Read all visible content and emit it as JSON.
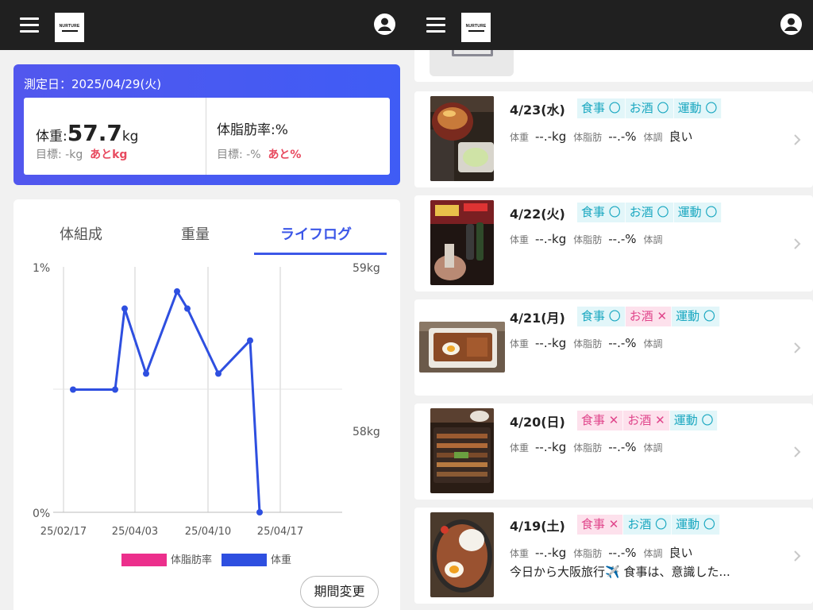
{
  "left": {
    "measurement": {
      "date_label": "測定日：2025/04/29(火)",
      "weight_label": "体重:",
      "weight_value": "57.7",
      "weight_unit": "kg",
      "weight_goal": "目標: -kg",
      "weight_remaining": "あとkg",
      "fat_label": "体脂肪率:%",
      "fat_goal": "目標: -%",
      "fat_remaining": "あと%"
    },
    "tabs": [
      {
        "label": "体組成",
        "active": false
      },
      {
        "label": "重量",
        "active": false
      },
      {
        "label": "ライフログ",
        "active": true
      }
    ],
    "period_button": "期間変更"
  },
  "right": {
    "entries": [
      {
        "date": "4/23(水)",
        "tags": [
          {
            "label": "食事 〇",
            "status": "ok"
          },
          {
            "label": "お酒 〇",
            "status": "ok"
          },
          {
            "label": "運動 〇",
            "status": "ok"
          }
        ],
        "weight_label": "体重",
        "weight": "--.-kg",
        "fat_label": "体脂肪",
        "fat": "--.-%",
        "cond_label": "体調",
        "cond": "良い",
        "memo": ""
      },
      {
        "date": "4/22(火)",
        "tags": [
          {
            "label": "食事 〇",
            "status": "ok"
          },
          {
            "label": "お酒 〇",
            "status": "ok"
          },
          {
            "label": "運動 〇",
            "status": "ok"
          }
        ],
        "weight_label": "体重",
        "weight": "--.-kg",
        "fat_label": "体脂肪",
        "fat": "--.-%",
        "cond_label": "体調",
        "cond": "",
        "memo": ""
      },
      {
        "date": "4/21(月)",
        "tags": [
          {
            "label": "食事 〇",
            "status": "ok"
          },
          {
            "label": "お酒 ✕",
            "status": "ng"
          },
          {
            "label": "運動 〇",
            "status": "ok"
          }
        ],
        "weight_label": "体重",
        "weight": "--.-kg",
        "fat_label": "体脂肪",
        "fat": "--.-%",
        "cond_label": "体調",
        "cond": "",
        "memo": ""
      },
      {
        "date": "4/20(日)",
        "tags": [
          {
            "label": "食事 ✕",
            "status": "ng"
          },
          {
            "label": "お酒 ✕",
            "status": "ng"
          },
          {
            "label": "運動 〇",
            "status": "ok"
          }
        ],
        "weight_label": "体重",
        "weight": "--.-kg",
        "fat_label": "体脂肪",
        "fat": "--.-%",
        "cond_label": "体調",
        "cond": "",
        "memo": ""
      },
      {
        "date": "4/19(土)",
        "tags": [
          {
            "label": "食事 ✕",
            "status": "ng"
          },
          {
            "label": "お酒 〇",
            "status": "ok"
          },
          {
            "label": "運動 〇",
            "status": "ok"
          }
        ],
        "weight_label": "体重",
        "weight": "--.-kg",
        "fat_label": "体脂肪",
        "fat": "--.-%",
        "cond_label": "体調",
        "cond": "良い",
        "memo": "今日から大阪旅行✈️ 食事は、意識した..."
      }
    ]
  },
  "chart_data": {
    "type": "line",
    "x_ticks": [
      "25/02/17",
      "25/04/03",
      "25/04/10",
      "25/04/17"
    ],
    "y_left_ticks": [
      "1%",
      "0%"
    ],
    "y_right_ticks": [
      "59kg",
      "58kg"
    ],
    "y_right_range": [
      57.0,
      59.0
    ],
    "legend": [
      "体脂肪率",
      "体重"
    ],
    "series": [
      {
        "name": "体重",
        "color": "#2e4fe0",
        "values": [
          58.0,
          58.0,
          58.66,
          58.13,
          58.8,
          58.66,
          58.13,
          58.4,
          57.0
        ]
      },
      {
        "name": "体脂肪率",
        "color": "#ec2f8c",
        "values": []
      }
    ],
    "grid": true,
    "legend_position": "bottom"
  }
}
